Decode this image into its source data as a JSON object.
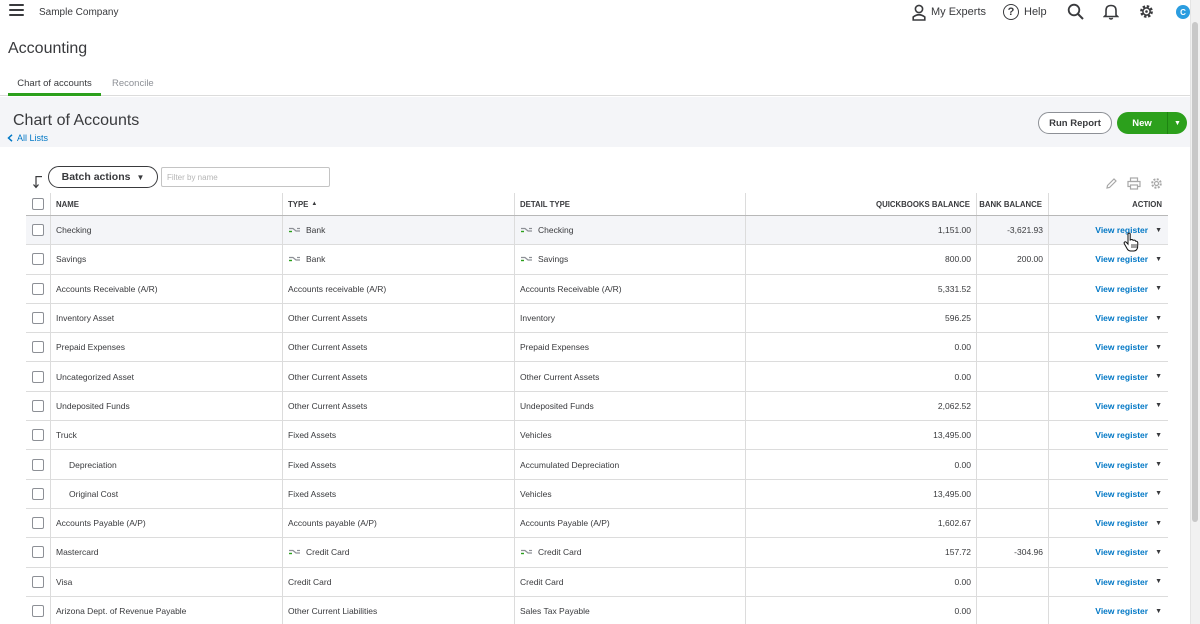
{
  "topbar": {
    "company": "Sample Company",
    "my_experts": "My Experts",
    "help": "Help",
    "help_glyph": "?",
    "avatar_initial": "C",
    "icons": [
      "menu-icon",
      "experts-icon",
      "help-icon",
      "search-icon",
      "bell-icon",
      "gear-icon"
    ]
  },
  "page": {
    "title": "Accounting",
    "tabs": [
      {
        "label": "Chart of accounts",
        "active": true
      },
      {
        "label": "Reconcile",
        "active": false
      }
    ]
  },
  "header": {
    "title": "Chart of Accounts",
    "back_link": "All Lists",
    "run_report": "Run Report",
    "new_label": "New"
  },
  "toolbar": {
    "batch_actions": "Batch actions",
    "filter_placeholder": "Filter by name"
  },
  "table": {
    "columns": {
      "name": "NAME",
      "type": "TYPE",
      "detail_type": "DETAIL TYPE",
      "qb_balance": "QUICKBOOKS BALANCE",
      "bank_balance": "BANK BALANCE",
      "action": "ACTION"
    },
    "action_label": "View register",
    "rows": [
      {
        "name": "Checking",
        "type": "Bank",
        "detail": "Checking",
        "qb": "1,151.00",
        "bank": "-3,621.93",
        "bank_icon": true
      },
      {
        "name": "Savings",
        "type": "Bank",
        "detail": "Savings",
        "qb": "800.00",
        "bank": "200.00",
        "bank_icon": true
      },
      {
        "name": "Accounts Receivable (A/R)",
        "type": "Accounts receivable (A/R)",
        "detail": "Accounts Receivable (A/R)",
        "qb": "5,331.52",
        "bank": ""
      },
      {
        "name": "Inventory Asset",
        "type": "Other Current Assets",
        "detail": "Inventory",
        "qb": "596.25",
        "bank": ""
      },
      {
        "name": "Prepaid Expenses",
        "type": "Other Current Assets",
        "detail": "Prepaid Expenses",
        "qb": "0.00",
        "bank": ""
      },
      {
        "name": "Uncategorized Asset",
        "type": "Other Current Assets",
        "detail": "Other Current Assets",
        "qb": "0.00",
        "bank": ""
      },
      {
        "name": "Undeposited Funds",
        "type": "Other Current Assets",
        "detail": "Undeposited Funds",
        "qb": "2,062.52",
        "bank": ""
      },
      {
        "name": "Truck",
        "type": "Fixed Assets",
        "detail": "Vehicles",
        "qb": "13,495.00",
        "bank": ""
      },
      {
        "name": "Depreciation",
        "type": "Fixed Assets",
        "detail": "Accumulated Depreciation",
        "qb": "0.00",
        "bank": "",
        "sub": true
      },
      {
        "name": "Original Cost",
        "type": "Fixed Assets",
        "detail": "Vehicles",
        "qb": "13,495.00",
        "bank": "",
        "sub": true
      },
      {
        "name": "Accounts Payable (A/P)",
        "type": "Accounts payable (A/P)",
        "detail": "Accounts Payable (A/P)",
        "qb": "1,602.67",
        "bank": ""
      },
      {
        "name": "Mastercard",
        "type": "Credit Card",
        "detail": "Credit Card",
        "qb": "157.72",
        "bank": "-304.96",
        "bank_icon": true
      },
      {
        "name": "Visa",
        "type": "Credit Card",
        "detail": "Credit Card",
        "qb": "0.00",
        "bank": ""
      },
      {
        "name": "Arizona Dept. of Revenue Payable",
        "type": "Other Current Liabilities",
        "detail": "Sales Tax Payable",
        "qb": "0.00",
        "bank": ""
      }
    ]
  },
  "colors": {
    "accent_green": "#2ca01c",
    "link_blue": "#0077c5",
    "text": "#393a3d"
  }
}
